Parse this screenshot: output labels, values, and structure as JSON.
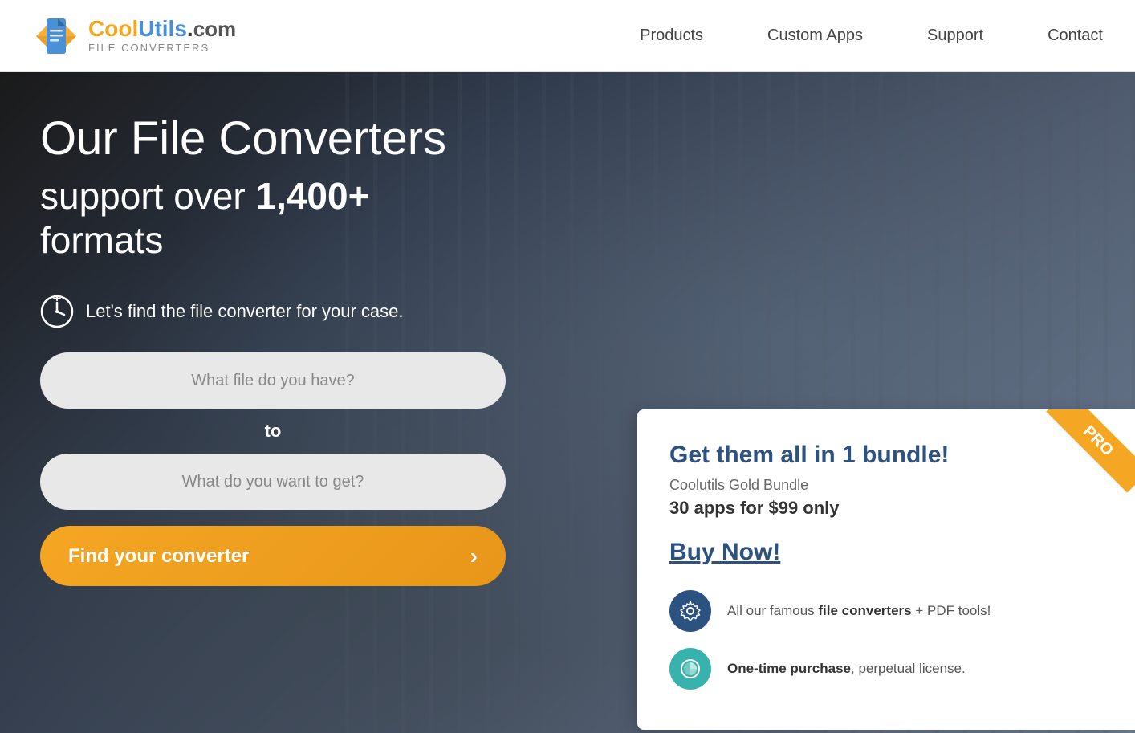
{
  "header": {
    "logo_cool": "Coo",
    "logo_l": "l",
    "logo_utils": "Utils",
    "logo_dot_com": ".com",
    "logo_subtitle": "file converters",
    "nav": {
      "products": "Products",
      "custom_apps": "Custom Apps",
      "support": "Support",
      "contact": "Contact"
    }
  },
  "hero": {
    "title": "Our File Converters",
    "subtitle_pre": "support over ",
    "subtitle_count": "1,400+",
    "subtitle_post": "formats",
    "tagline": "Let's find the file converter for your case.",
    "input1_placeholder": "What file do you have?",
    "to_label": "to",
    "input2_placeholder": "What do you want to get?",
    "find_button": "Find your converter",
    "find_button_arrow": "›"
  },
  "bundle": {
    "pro_badge": "PRO",
    "title": "Get them all in 1 bundle!",
    "subtitle": "Coolutils Gold Bundle",
    "price": "30 apps for $99 only",
    "buy_link": "Buy Now!",
    "feature1_text_pre": "All our famous ",
    "feature1_bold": "file converters",
    "feature1_text_post": " + PDF tools!",
    "feature1_icon": "⚙",
    "feature2_text_pre": "",
    "feature2_bold": "One-time purchase",
    "feature2_text_post": ", perpetual license.",
    "feature2_icon": "📊"
  }
}
